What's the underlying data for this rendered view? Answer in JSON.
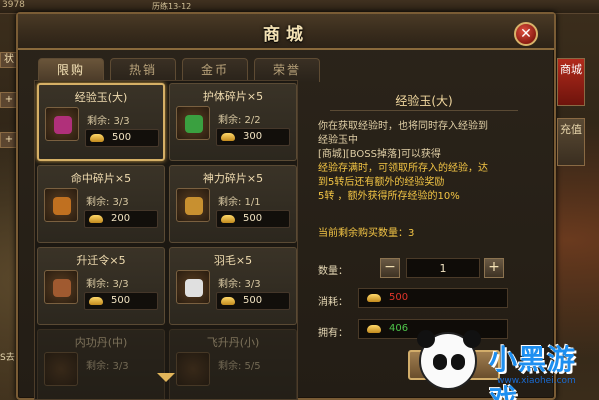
{
  "hud": {
    "stat": "3978",
    "level": "历练13-12"
  },
  "side_left": {
    "tab1": "状",
    "tab2": "+",
    "tab3": "+",
    "bottom": "S去"
  },
  "window": {
    "title": "商城",
    "close_label": "✕"
  },
  "tabs": [
    {
      "label": "限购",
      "active": true
    },
    {
      "label": "热销",
      "active": false
    },
    {
      "label": "金币",
      "active": false
    },
    {
      "label": "荣誉",
      "active": false
    }
  ],
  "items": [
    {
      "name": "经验玉(大)",
      "remain": "剩余: 3/3",
      "price": "500",
      "color": "#b0307a",
      "selected": true
    },
    {
      "name": "护体碎片×5",
      "remain": "剩余: 2/2",
      "price": "300",
      "color": "#3aa040",
      "selected": false
    },
    {
      "name": "命中碎片×5",
      "remain": "剩余: 3/3",
      "price": "200",
      "color": "#c07020",
      "selected": false
    },
    {
      "name": "神力碎片×5",
      "remain": "剩余: 1/1",
      "price": "500",
      "color": "#c89030",
      "selected": false
    },
    {
      "name": "升迁令×5",
      "remain": "剩余: 3/3",
      "price": "500",
      "color": "#a05a30",
      "selected": false
    },
    {
      "name": "羽毛×5",
      "remain": "剩余: 3/3",
      "price": "500",
      "color": "#e0e0e0",
      "selected": false
    },
    {
      "name": "内功丹(中)",
      "remain": "剩余: 3/3",
      "price": "",
      "color": "#8a6a44",
      "selected": false
    },
    {
      "name": "飞升丹(小)",
      "remain": "剩余: 5/5",
      "price": "",
      "color": "#8a6a44",
      "selected": false
    }
  ],
  "detail": {
    "title": "经验玉(大)",
    "desc_lines": [
      {
        "text": "你在获取经验时，也将同时存入经验到",
        "hl": false
      },
      {
        "text": "经验玉中",
        "hl": false
      },
      {
        "text": "[商城][BOSS掉落]可以获得",
        "hl": false
      },
      {
        "text": "经验存满时，可领取所存入的经验，达",
        "hl": true
      },
      {
        "text": "到5转后还有额外的经验奖励",
        "hl": true
      },
      {
        "text": "5转   ，额外获得所存经验的10%",
        "hl": true
      }
    ],
    "remaining_buy": "当前剩余购买数量：3",
    "qty_label": "数量：",
    "qty_value": "1",
    "minus": "−",
    "plus": "+",
    "cost_label": "消耗：",
    "cost_value": "500",
    "cost_color": "#e0352a",
    "own_label": "拥有：",
    "own_value": "406",
    "own_color": "#4ec44a"
  },
  "side_tabs": [
    {
      "label": "商城",
      "active": true
    },
    {
      "label": "充值",
      "active": false
    }
  ],
  "watermark": {
    "brand": "小黑游戏",
    "url": "www.xiaohei.com"
  }
}
